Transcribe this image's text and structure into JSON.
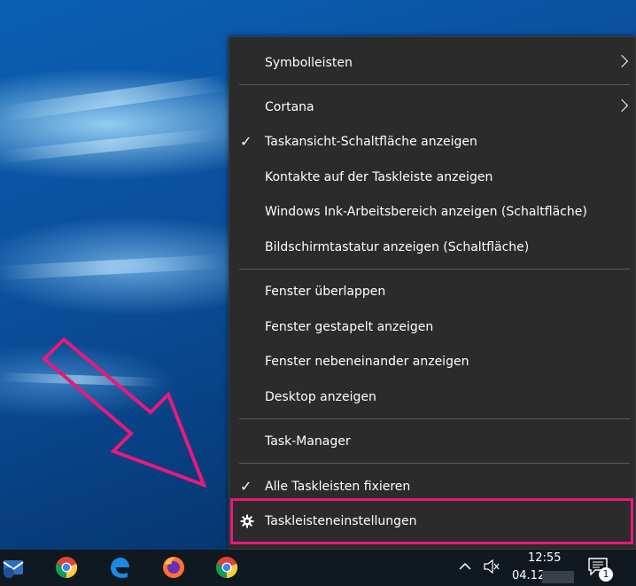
{
  "context_menu": {
    "items": [
      {
        "label": "Symbolleisten",
        "submenu": true,
        "checked": false
      },
      {
        "label": "Cortana",
        "submenu": true,
        "checked": false
      },
      {
        "label": "Taskansicht-Schaltfläche anzeigen",
        "submenu": false,
        "checked": true
      },
      {
        "label": "Kontakte auf der Taskleiste anzeigen",
        "submenu": false,
        "checked": false
      },
      {
        "label": "Windows Ink-Arbeitsbereich anzeigen (Schaltfläche)",
        "submenu": false,
        "checked": false
      },
      {
        "label": "Bildschirmtastatur anzeigen (Schaltfläche)",
        "submenu": false,
        "checked": false
      },
      {
        "label": "Fenster überlappen",
        "submenu": false,
        "checked": false
      },
      {
        "label": "Fenster gestapelt anzeigen",
        "submenu": false,
        "checked": false
      },
      {
        "label": "Fenster nebeneinander anzeigen",
        "submenu": false,
        "checked": false
      },
      {
        "label": "Desktop anzeigen",
        "submenu": false,
        "checked": false
      },
      {
        "label": "Task-Manager",
        "submenu": false,
        "checked": false
      },
      {
        "label": "Alle Taskleisten fixieren",
        "submenu": false,
        "checked": true
      },
      {
        "label": "Taskleisteneinstellungen",
        "submenu": false,
        "checked": false,
        "icon": "gear-icon"
      }
    ],
    "check_glyph": "✓"
  },
  "taskbar": {
    "apps": [
      {
        "name": "mail-app-icon"
      },
      {
        "name": "chrome-icon"
      },
      {
        "name": "edge-icon"
      },
      {
        "name": "firefox-icon"
      },
      {
        "name": "chrome-icon"
      }
    ],
    "tray": {
      "time": "12:55",
      "date": "04.12.",
      "notification_count": "1",
      "chevron_glyph": "^",
      "icons": [
        "chevron-up-icon",
        "volume-muted-icon",
        "action-center-icon"
      ]
    }
  },
  "colors": {
    "menu_bg": "#2b2b2b",
    "highlight": "#e8197d",
    "taskbar_bg": "#101820"
  }
}
